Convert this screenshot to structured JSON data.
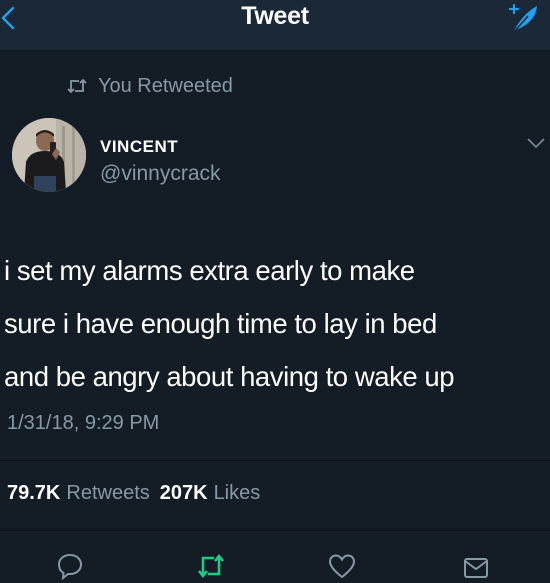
{
  "header": {
    "title": "Tweet",
    "back_icon": "chevron-left-icon",
    "compose_icon": "compose-feather-icon"
  },
  "retweet_context": {
    "icon": "retweet-icon",
    "label": "You Retweeted"
  },
  "author": {
    "display_name": "VINCENT",
    "handle": "@vinnycrack"
  },
  "tweet": {
    "lines": [
      "i set my alarms extra early to make",
      "sure i have enough time to lay in bed",
      "and be angry about having to wake up"
    ],
    "timestamp": "1/31/18, 9:29 PM"
  },
  "stats": {
    "retweets_count": "79.7K",
    "retweets_label": "Retweets",
    "likes_count": "207K",
    "likes_label": "Likes"
  },
  "actions": [
    {
      "icon": "reply-icon"
    },
    {
      "icon": "retweet-icon",
      "active": true
    },
    {
      "icon": "heart-icon"
    },
    {
      "icon": "share-icon"
    }
  ],
  "colors": {
    "background": "#141d26",
    "header_background": "#1b2836",
    "secondary_text": "#8899a6",
    "accent_blue": "#1da1f2",
    "retweet_green": "#19cf86"
  }
}
